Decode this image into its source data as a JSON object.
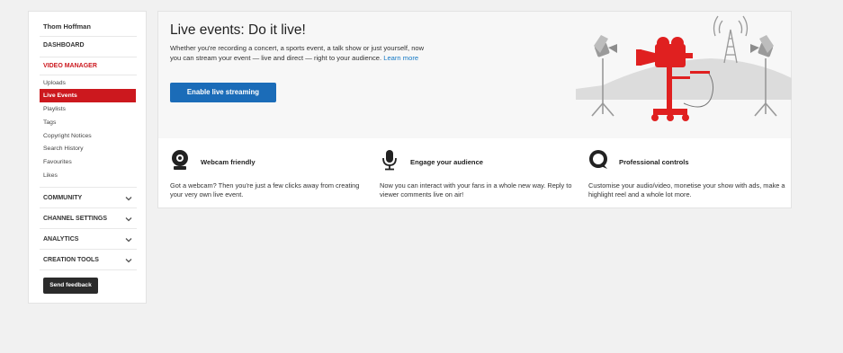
{
  "sidebar": {
    "user": "Thom Hoffman",
    "dashboard": "DASHBOARD",
    "video_manager": "VIDEO MANAGER",
    "items": [
      "Uploads",
      "Live Events",
      "Playlists",
      "Tags",
      "Copyright Notices",
      "Search History",
      "Favourites",
      "Likes"
    ],
    "sections": [
      "COMMUNITY",
      "CHANNEL SETTINGS",
      "ANALYTICS",
      "CREATION TOOLS"
    ],
    "feedback": "Send feedback"
  },
  "hero": {
    "title": "Live events: Do it live!",
    "desc": "Whether you're recording a concert, a sports event, a talk show or just yourself, now you can stream your event — live and direct — right to your audience.",
    "learn_more": "Learn more",
    "button": "Enable live streaming"
  },
  "features": [
    {
      "icon": "webcam-icon",
      "title": "Webcam friendly",
      "desc": "Got a webcam? Then you're just a few clicks away from creating your very own live event."
    },
    {
      "icon": "microphone-icon",
      "title": "Engage your audience",
      "desc": "Now you can interact with your fans in a whole new way. Reply to viewer comments live on air!"
    },
    {
      "icon": "controls-icon",
      "title": "Professional controls",
      "desc": "Customise your audio/video, monetise your show with ads, make a highlight reel and a whole lot more."
    }
  ],
  "colors": {
    "accent_red": "#cc181e",
    "button_blue": "#1b6cb8",
    "link": "#167ac6"
  }
}
